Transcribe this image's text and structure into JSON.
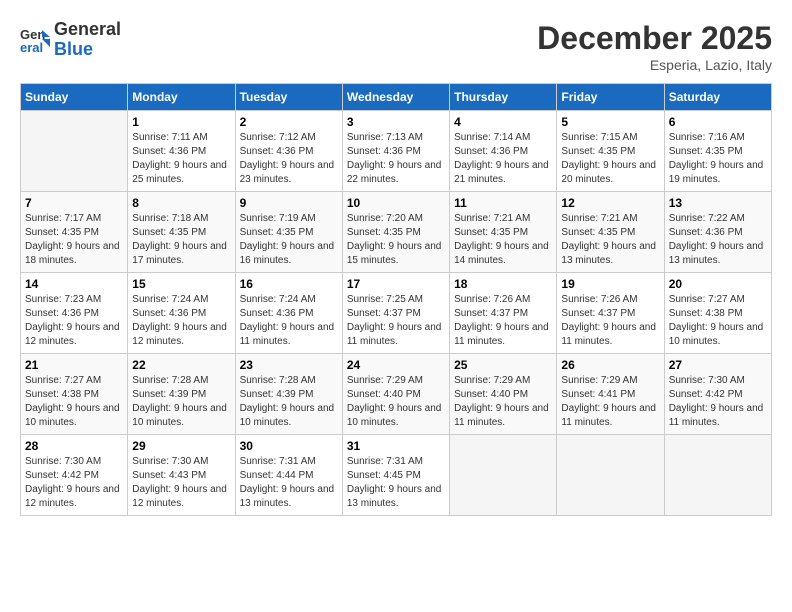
{
  "header": {
    "logo_line1": "General",
    "logo_line2": "Blue",
    "month": "December 2025",
    "location": "Esperia, Lazio, Italy"
  },
  "weekdays": [
    "Sunday",
    "Monday",
    "Tuesday",
    "Wednesday",
    "Thursday",
    "Friday",
    "Saturday"
  ],
  "weeks": [
    [
      {
        "day": "",
        "sunrise": "",
        "sunset": "",
        "daylight": ""
      },
      {
        "day": "1",
        "sunrise": "7:11 AM",
        "sunset": "4:36 PM",
        "daylight": "9 hours and 25 minutes."
      },
      {
        "day": "2",
        "sunrise": "7:12 AM",
        "sunset": "4:36 PM",
        "daylight": "9 hours and 23 minutes."
      },
      {
        "day": "3",
        "sunrise": "7:13 AM",
        "sunset": "4:36 PM",
        "daylight": "9 hours and 22 minutes."
      },
      {
        "day": "4",
        "sunrise": "7:14 AM",
        "sunset": "4:36 PM",
        "daylight": "9 hours and 21 minutes."
      },
      {
        "day": "5",
        "sunrise": "7:15 AM",
        "sunset": "4:35 PM",
        "daylight": "9 hours and 20 minutes."
      },
      {
        "day": "6",
        "sunrise": "7:16 AM",
        "sunset": "4:35 PM",
        "daylight": "9 hours and 19 minutes."
      }
    ],
    [
      {
        "day": "7",
        "sunrise": "7:17 AM",
        "sunset": "4:35 PM",
        "daylight": "9 hours and 18 minutes."
      },
      {
        "day": "8",
        "sunrise": "7:18 AM",
        "sunset": "4:35 PM",
        "daylight": "9 hours and 17 minutes."
      },
      {
        "day": "9",
        "sunrise": "7:19 AM",
        "sunset": "4:35 PM",
        "daylight": "9 hours and 16 minutes."
      },
      {
        "day": "10",
        "sunrise": "7:20 AM",
        "sunset": "4:35 PM",
        "daylight": "9 hours and 15 minutes."
      },
      {
        "day": "11",
        "sunrise": "7:21 AM",
        "sunset": "4:35 PM",
        "daylight": "9 hours and 14 minutes."
      },
      {
        "day": "12",
        "sunrise": "7:21 AM",
        "sunset": "4:35 PM",
        "daylight": "9 hours and 13 minutes."
      },
      {
        "day": "13",
        "sunrise": "7:22 AM",
        "sunset": "4:36 PM",
        "daylight": "9 hours and 13 minutes."
      }
    ],
    [
      {
        "day": "14",
        "sunrise": "7:23 AM",
        "sunset": "4:36 PM",
        "daylight": "9 hours and 12 minutes."
      },
      {
        "day": "15",
        "sunrise": "7:24 AM",
        "sunset": "4:36 PM",
        "daylight": "9 hours and 12 minutes."
      },
      {
        "day": "16",
        "sunrise": "7:24 AM",
        "sunset": "4:36 PM",
        "daylight": "9 hours and 11 minutes."
      },
      {
        "day": "17",
        "sunrise": "7:25 AM",
        "sunset": "4:37 PM",
        "daylight": "9 hours and 11 minutes."
      },
      {
        "day": "18",
        "sunrise": "7:26 AM",
        "sunset": "4:37 PM",
        "daylight": "9 hours and 11 minutes."
      },
      {
        "day": "19",
        "sunrise": "7:26 AM",
        "sunset": "4:37 PM",
        "daylight": "9 hours and 11 minutes."
      },
      {
        "day": "20",
        "sunrise": "7:27 AM",
        "sunset": "4:38 PM",
        "daylight": "9 hours and 10 minutes."
      }
    ],
    [
      {
        "day": "21",
        "sunrise": "7:27 AM",
        "sunset": "4:38 PM",
        "daylight": "9 hours and 10 minutes."
      },
      {
        "day": "22",
        "sunrise": "7:28 AM",
        "sunset": "4:39 PM",
        "daylight": "9 hours and 10 minutes."
      },
      {
        "day": "23",
        "sunrise": "7:28 AM",
        "sunset": "4:39 PM",
        "daylight": "9 hours and 10 minutes."
      },
      {
        "day": "24",
        "sunrise": "7:29 AM",
        "sunset": "4:40 PM",
        "daylight": "9 hours and 10 minutes."
      },
      {
        "day": "25",
        "sunrise": "7:29 AM",
        "sunset": "4:40 PM",
        "daylight": "9 hours and 11 minutes."
      },
      {
        "day": "26",
        "sunrise": "7:29 AM",
        "sunset": "4:41 PM",
        "daylight": "9 hours and 11 minutes."
      },
      {
        "day": "27",
        "sunrise": "7:30 AM",
        "sunset": "4:42 PM",
        "daylight": "9 hours and 11 minutes."
      }
    ],
    [
      {
        "day": "28",
        "sunrise": "7:30 AM",
        "sunset": "4:42 PM",
        "daylight": "9 hours and 12 minutes."
      },
      {
        "day": "29",
        "sunrise": "7:30 AM",
        "sunset": "4:43 PM",
        "daylight": "9 hours and 12 minutes."
      },
      {
        "day": "30",
        "sunrise": "7:31 AM",
        "sunset": "4:44 PM",
        "daylight": "9 hours and 13 minutes."
      },
      {
        "day": "31",
        "sunrise": "7:31 AM",
        "sunset": "4:45 PM",
        "daylight": "9 hours and 13 minutes."
      },
      {
        "day": "",
        "sunrise": "",
        "sunset": "",
        "daylight": ""
      },
      {
        "day": "",
        "sunrise": "",
        "sunset": "",
        "daylight": ""
      },
      {
        "day": "",
        "sunrise": "",
        "sunset": "",
        "daylight": ""
      }
    ]
  ],
  "labels": {
    "sunrise": "Sunrise:",
    "sunset": "Sunset:",
    "daylight": "Daylight:"
  }
}
